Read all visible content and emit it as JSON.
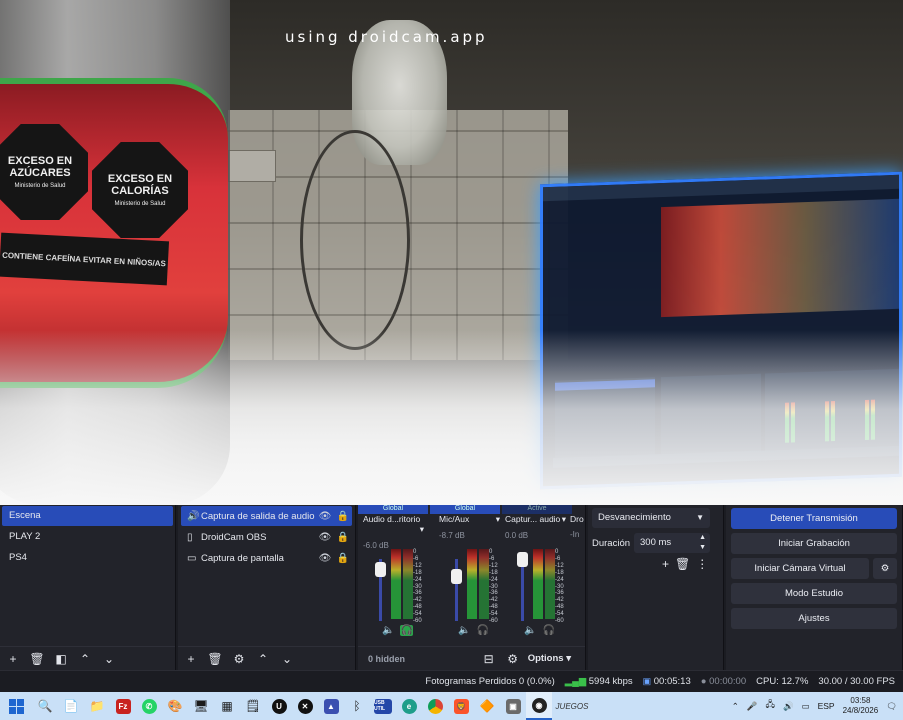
{
  "preview": {
    "watermark": "using droidcam.app",
    "label_sign_1": "EXCESO EN AZÚCARES",
    "label_sign_2": "EXCESO EN CALORÍAS",
    "label_sign_sub": "Ministerio de Salud",
    "label_warning": "CONTIENE CAFEÍNA EVITAR EN NIÑOS/AS"
  },
  "scenes": {
    "items": [
      {
        "label": "Escena",
        "selected": true
      },
      {
        "label": "PLAY 2",
        "selected": false
      },
      {
        "label": "PS4",
        "selected": false
      }
    ]
  },
  "sources": {
    "items": [
      {
        "label": "Captura de salida de audio",
        "icon": "speaker-icon",
        "selected": true
      },
      {
        "label": "DroidCam OBS",
        "icon": "camera-icon",
        "selected": false
      },
      {
        "label": "Captura de pantalla",
        "icon": "monitor-icon",
        "selected": false
      }
    ]
  },
  "mixer": {
    "tabs": [
      "Global",
      "Global",
      "Active"
    ],
    "channels": [
      {
        "name": "Audio d...ritorio",
        "db": "-6.0 dB",
        "headphone_active": true
      },
      {
        "name": "Mic/Aux",
        "db": "-8.7 dB",
        "headphone_active": false
      },
      {
        "name": "Captur... audio",
        "db": "0.0 dB",
        "headphone_active": false
      }
    ],
    "partial_channel": {
      "name": "Dro",
      "db": "-In"
    },
    "scale": [
      "0",
      "-6",
      "-12",
      "-18",
      "-24",
      "-30",
      "-36",
      "-42",
      "-48",
      "-54",
      "-60"
    ],
    "hidden_label": "0 hidden",
    "options_label": "Options"
  },
  "transitions": {
    "type": "Desvanecimiento",
    "duration_label": "Duración",
    "duration_value": "300 ms"
  },
  "controls": {
    "stop_stream": "Detener Transmisión",
    "start_recording": "Iniciar Grabación",
    "start_virtual_cam": "Iniciar Cámara Virtual",
    "studio_mode": "Modo Estudio",
    "settings": "Ajustes"
  },
  "status": {
    "dropped_frames": "Fotogramas Perdidos 0 (0.0%)",
    "bitrate": "5994 kbps",
    "stream_time": "00:05:13",
    "record_time": "00:00:00",
    "cpu": "CPU: 12.7%",
    "fps": "30.00 / 30.00 FPS"
  },
  "taskbar": {
    "juegos_label": "JUEGOS",
    "lang": "ESP",
    "time": "03:58",
    "date": "24/8/2026",
    "usb_label": "USB UTIL"
  },
  "colors": {
    "accent": "#284cb8",
    "panel": "#22232a",
    "meter_green": "#27a83b",
    "taskbar": "#c9e0f7"
  }
}
